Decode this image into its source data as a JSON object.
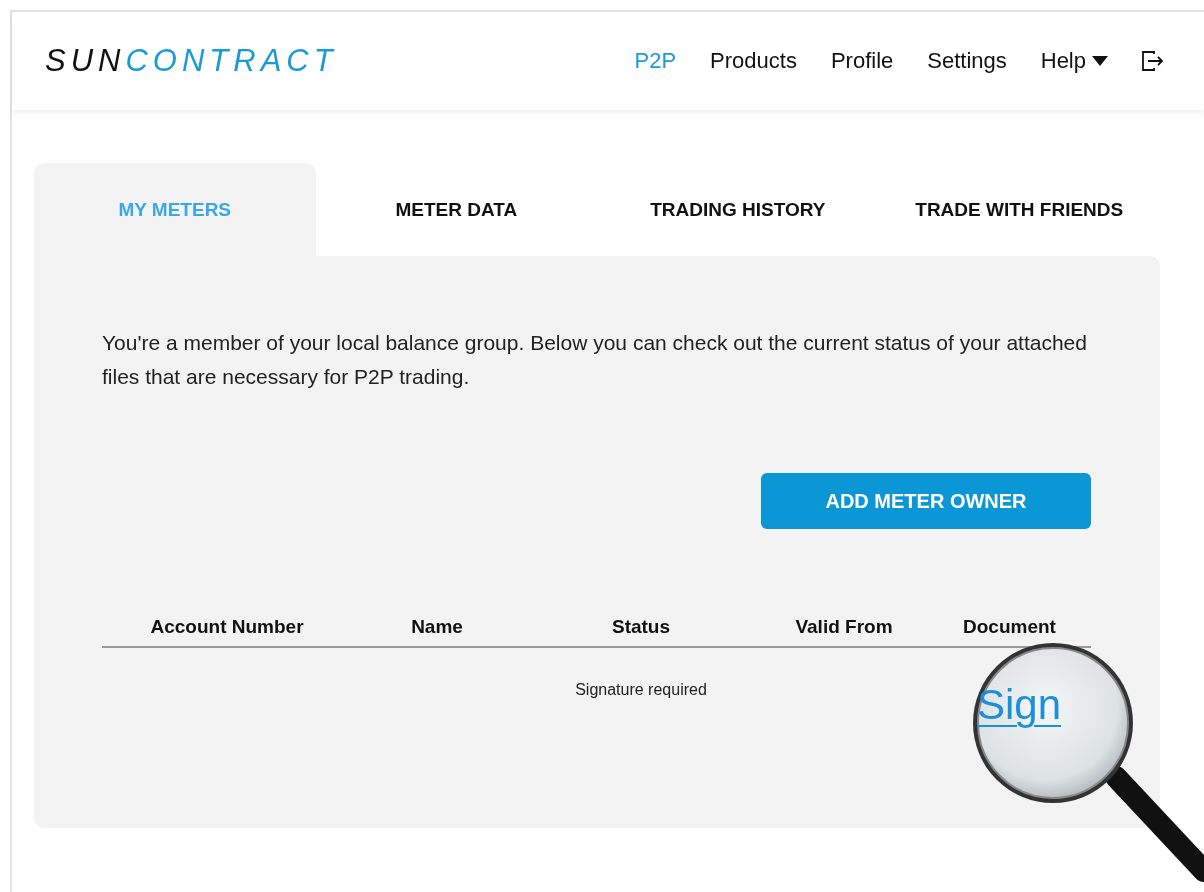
{
  "header": {
    "logo": {
      "dark": "SUN",
      "accent": "CONTRACT"
    },
    "nav": [
      {
        "label": "P2P",
        "selected": true,
        "kind": "link"
      },
      {
        "label": "Products",
        "selected": false,
        "kind": "link"
      },
      {
        "label": "Profile",
        "selected": false,
        "kind": "link"
      },
      {
        "label": "Settings",
        "selected": false,
        "kind": "link"
      },
      {
        "label": "Help",
        "selected": false,
        "kind": "dropdown"
      }
    ]
  },
  "tabs": [
    {
      "label": "MY METERS",
      "selected": true
    },
    {
      "label": "METER DATA",
      "selected": false
    },
    {
      "label": "TRADING HISTORY",
      "selected": false
    },
    {
      "label": "TRADE WITH FRIENDS",
      "selected": false
    }
  ],
  "intro": "You're a member of your local balance group. Below you can check out the current status of your attached files that are necessary for P2P trading.",
  "add_button": "ADD METER OWNER",
  "table": {
    "columns": [
      "Account Number",
      "Name",
      "Status",
      "Valid From",
      "Document"
    ],
    "rows": [
      {
        "status": "Signature required",
        "document": "Sign"
      }
    ]
  }
}
